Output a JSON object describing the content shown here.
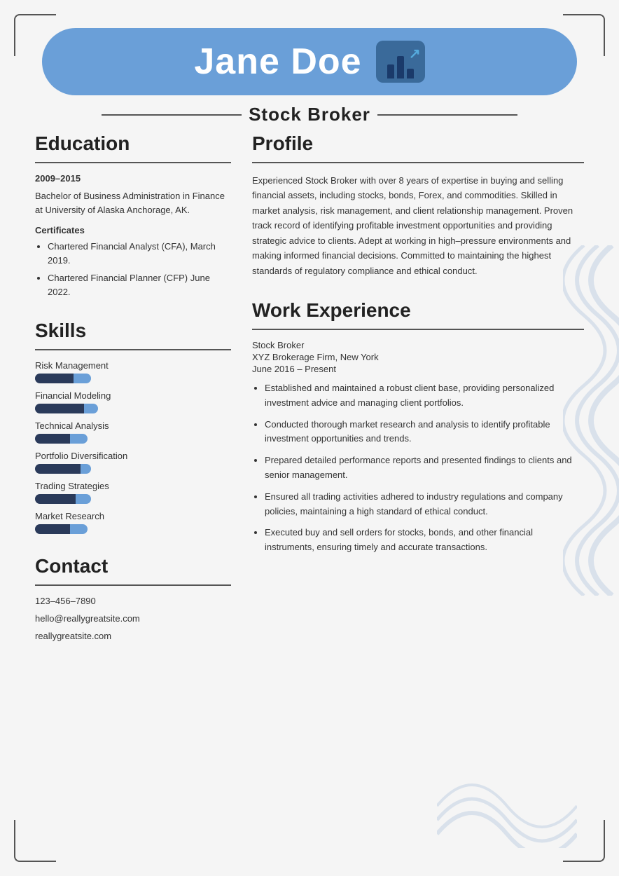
{
  "header": {
    "name": "Jane Doe",
    "job_title": "Stock Broker"
  },
  "education": {
    "section_title": "Education",
    "date_range": "2009–2015",
    "degree": "Bachelor of Business Administration in Finance at University of Alaska Anchorage, AK.",
    "cert_label": "Certificates",
    "certs": [
      "Chartered Financial Analyst (CFA), March 2019.",
      "Chartered Financial Planner (CFP) June 2022."
    ]
  },
  "skills": {
    "section_title": "Skills",
    "items": [
      {
        "label": "Risk Management",
        "filled": 55,
        "blue": 25
      },
      {
        "label": "Financial Modeling",
        "filled": 70,
        "blue": 20
      },
      {
        "label": "Technical Analysis",
        "filled": 50,
        "blue": 25
      },
      {
        "label": "Portfolio Diversification",
        "filled": 65,
        "blue": 15
      },
      {
        "label": "Trading Strategies",
        "filled": 58,
        "blue": 22
      },
      {
        "label": "Market Research",
        "filled": 50,
        "blue": 25
      }
    ]
  },
  "contact": {
    "section_title": "Contact",
    "phone": "123–456–7890",
    "email": "hello@reallygreatsite.com",
    "website": "reallygreatsite.com"
  },
  "profile": {
    "section_title": "Profile",
    "text": "Experienced Stock Broker with over 8 years of expertise in buying and selling financial assets, including stocks, bonds, Forex, and commodities. Skilled in market analysis, risk management, and client relationship management. Proven track record of identifying profitable investment opportunities and providing strategic advice to clients. Adept at working in high–pressure environments and making informed financial decisions. Committed to maintaining the highest standards of regulatory compliance and ethical conduct."
  },
  "work_experience": {
    "section_title": "Work Experience",
    "job_title": "Stock Broker",
    "company": "XYZ Brokerage Firm, New York",
    "period": "June 2016 – Present",
    "bullets": [
      "Established and maintained a robust client base, providing personalized investment advice and managing client portfolios.",
      "Conducted thorough market research and analysis to identify profitable investment opportunities and trends.",
      "Prepared detailed performance reports and presented findings to clients and senior management.",
      "Ensured all trading activities adhered to industry regulations and company policies, maintaining a high standard of ethical conduct.",
      "Executed buy and sell orders for stocks, bonds, and other financial instruments, ensuring timely and accurate transactions."
    ]
  }
}
